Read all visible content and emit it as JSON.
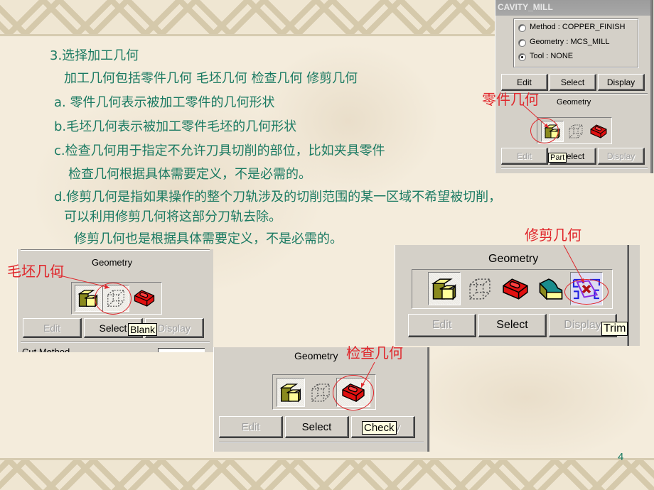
{
  "slide": {
    "page_number": "4",
    "lines": [
      "3.选择加工几何",
      "加工几何包括零件几何 毛坯几何 检查几何 修剪几何",
      "a. 零件几何表示被加工零件的几何形状",
      "b.毛坯几何表示被加工零件毛坯的几何形状",
      "c.检查几何用于指定不允许刀具切削的部位，比如夹具零件",
      "检查几何根据具体需要定义，不是必需的。",
      "d.修剪几何是指如果操作的整个刀轨涉及的切削范围的某一区域不希望被切削，",
      "可以利用修剪几何将这部分刀轨去除。",
      "修剪几何也是根据具体需要定义，不是必需的。"
    ],
    "annotations": {
      "part": "零件几何",
      "blank": "毛坯几何",
      "check": "检查几何",
      "trim": "修剪几何"
    },
    "colors": {
      "text": "#1a7a62",
      "annotation": "#e0262b",
      "panel": "#d4d0c8",
      "tooltip": "#ffffe1"
    }
  },
  "cavity_panel": {
    "title": "CAVITY_MILL",
    "radios": [
      {
        "label": "Method : COPPER_FINISH",
        "selected": false
      },
      {
        "label": "Geometry : MCS_MILL",
        "selected": false
      },
      {
        "label": "Tool : NONE",
        "selected": true
      }
    ],
    "buttons_top": [
      "Edit",
      "Select",
      "Display"
    ],
    "geometry_label": "Geometry",
    "icons": [
      "part-icon",
      "blank-icon",
      "check-icon"
    ],
    "buttons_bottom": [
      "Edit",
      "Select",
      "Display"
    ],
    "tooltip": "Part"
  },
  "blank_panel": {
    "geometry_label": "Geometry",
    "icons": [
      "part-icon",
      "blank-icon",
      "check-icon"
    ],
    "buttons": [
      "Edit",
      "Select",
      "Display"
    ],
    "tooltip": "Blank",
    "cut_label": "Cut Method"
  },
  "trim_panel": {
    "geometry_label": "Geometry",
    "icons": [
      "part-icon",
      "blank-icon",
      "check-icon",
      "cut-area-icon",
      "trim-icon"
    ],
    "buttons": [
      "Edit",
      "Select",
      "Display"
    ],
    "tooltip": "Trim"
  },
  "check_panel": {
    "geometry_label": "Geometry",
    "icons": [
      "part-icon",
      "blank-icon",
      "check-icon"
    ],
    "buttons": [
      "Edit",
      "Select",
      "Display"
    ],
    "tooltip": "Check"
  }
}
